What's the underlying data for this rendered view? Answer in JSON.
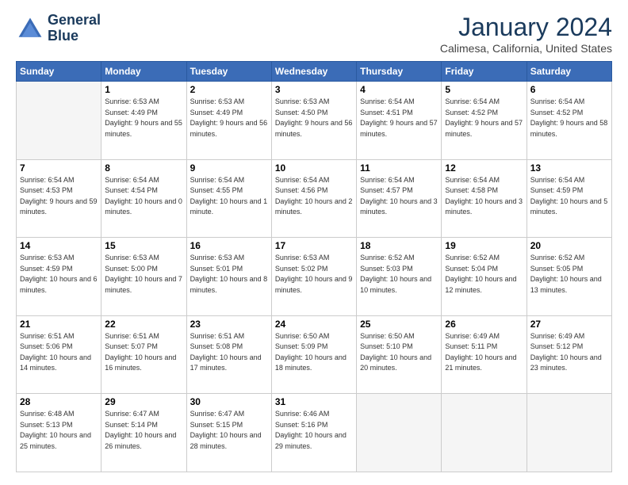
{
  "header": {
    "logo_line1": "General",
    "logo_line2": "Blue",
    "month_year": "January 2024",
    "location": "Calimesa, California, United States"
  },
  "weekdays": [
    "Sunday",
    "Monday",
    "Tuesday",
    "Wednesday",
    "Thursday",
    "Friday",
    "Saturday"
  ],
  "weeks": [
    [
      {
        "day": "",
        "sunrise": "",
        "sunset": "",
        "daylight": "",
        "empty": true
      },
      {
        "day": "1",
        "sunrise": "Sunrise: 6:53 AM",
        "sunset": "Sunset: 4:49 PM",
        "daylight": "Daylight: 9 hours and 55 minutes."
      },
      {
        "day": "2",
        "sunrise": "Sunrise: 6:53 AM",
        "sunset": "Sunset: 4:49 PM",
        "daylight": "Daylight: 9 hours and 56 minutes."
      },
      {
        "day": "3",
        "sunrise": "Sunrise: 6:53 AM",
        "sunset": "Sunset: 4:50 PM",
        "daylight": "Daylight: 9 hours and 56 minutes."
      },
      {
        "day": "4",
        "sunrise": "Sunrise: 6:54 AM",
        "sunset": "Sunset: 4:51 PM",
        "daylight": "Daylight: 9 hours and 57 minutes."
      },
      {
        "day": "5",
        "sunrise": "Sunrise: 6:54 AM",
        "sunset": "Sunset: 4:52 PM",
        "daylight": "Daylight: 9 hours and 57 minutes."
      },
      {
        "day": "6",
        "sunrise": "Sunrise: 6:54 AM",
        "sunset": "Sunset: 4:52 PM",
        "daylight": "Daylight: 9 hours and 58 minutes."
      }
    ],
    [
      {
        "day": "7",
        "sunrise": "Sunrise: 6:54 AM",
        "sunset": "Sunset: 4:53 PM",
        "daylight": "Daylight: 9 hours and 59 minutes."
      },
      {
        "day": "8",
        "sunrise": "Sunrise: 6:54 AM",
        "sunset": "Sunset: 4:54 PM",
        "daylight": "Daylight: 10 hours and 0 minutes."
      },
      {
        "day": "9",
        "sunrise": "Sunrise: 6:54 AM",
        "sunset": "Sunset: 4:55 PM",
        "daylight": "Daylight: 10 hours and 1 minute."
      },
      {
        "day": "10",
        "sunrise": "Sunrise: 6:54 AM",
        "sunset": "Sunset: 4:56 PM",
        "daylight": "Daylight: 10 hours and 2 minutes."
      },
      {
        "day": "11",
        "sunrise": "Sunrise: 6:54 AM",
        "sunset": "Sunset: 4:57 PM",
        "daylight": "Daylight: 10 hours and 3 minutes."
      },
      {
        "day": "12",
        "sunrise": "Sunrise: 6:54 AM",
        "sunset": "Sunset: 4:58 PM",
        "daylight": "Daylight: 10 hours and 3 minutes."
      },
      {
        "day": "13",
        "sunrise": "Sunrise: 6:54 AM",
        "sunset": "Sunset: 4:59 PM",
        "daylight": "Daylight: 10 hours and 5 minutes."
      }
    ],
    [
      {
        "day": "14",
        "sunrise": "Sunrise: 6:53 AM",
        "sunset": "Sunset: 4:59 PM",
        "daylight": "Daylight: 10 hours and 6 minutes."
      },
      {
        "day": "15",
        "sunrise": "Sunrise: 6:53 AM",
        "sunset": "Sunset: 5:00 PM",
        "daylight": "Daylight: 10 hours and 7 minutes."
      },
      {
        "day": "16",
        "sunrise": "Sunrise: 6:53 AM",
        "sunset": "Sunset: 5:01 PM",
        "daylight": "Daylight: 10 hours and 8 minutes."
      },
      {
        "day": "17",
        "sunrise": "Sunrise: 6:53 AM",
        "sunset": "Sunset: 5:02 PM",
        "daylight": "Daylight: 10 hours and 9 minutes."
      },
      {
        "day": "18",
        "sunrise": "Sunrise: 6:52 AM",
        "sunset": "Sunset: 5:03 PM",
        "daylight": "Daylight: 10 hours and 10 minutes."
      },
      {
        "day": "19",
        "sunrise": "Sunrise: 6:52 AM",
        "sunset": "Sunset: 5:04 PM",
        "daylight": "Daylight: 10 hours and 12 minutes."
      },
      {
        "day": "20",
        "sunrise": "Sunrise: 6:52 AM",
        "sunset": "Sunset: 5:05 PM",
        "daylight": "Daylight: 10 hours and 13 minutes."
      }
    ],
    [
      {
        "day": "21",
        "sunrise": "Sunrise: 6:51 AM",
        "sunset": "Sunset: 5:06 PM",
        "daylight": "Daylight: 10 hours and 14 minutes."
      },
      {
        "day": "22",
        "sunrise": "Sunrise: 6:51 AM",
        "sunset": "Sunset: 5:07 PM",
        "daylight": "Daylight: 10 hours and 16 minutes."
      },
      {
        "day": "23",
        "sunrise": "Sunrise: 6:51 AM",
        "sunset": "Sunset: 5:08 PM",
        "daylight": "Daylight: 10 hours and 17 minutes."
      },
      {
        "day": "24",
        "sunrise": "Sunrise: 6:50 AM",
        "sunset": "Sunset: 5:09 PM",
        "daylight": "Daylight: 10 hours and 18 minutes."
      },
      {
        "day": "25",
        "sunrise": "Sunrise: 6:50 AM",
        "sunset": "Sunset: 5:10 PM",
        "daylight": "Daylight: 10 hours and 20 minutes."
      },
      {
        "day": "26",
        "sunrise": "Sunrise: 6:49 AM",
        "sunset": "Sunset: 5:11 PM",
        "daylight": "Daylight: 10 hours and 21 minutes."
      },
      {
        "day": "27",
        "sunrise": "Sunrise: 6:49 AM",
        "sunset": "Sunset: 5:12 PM",
        "daylight": "Daylight: 10 hours and 23 minutes."
      }
    ],
    [
      {
        "day": "28",
        "sunrise": "Sunrise: 6:48 AM",
        "sunset": "Sunset: 5:13 PM",
        "daylight": "Daylight: 10 hours and 25 minutes."
      },
      {
        "day": "29",
        "sunrise": "Sunrise: 6:47 AM",
        "sunset": "Sunset: 5:14 PM",
        "daylight": "Daylight: 10 hours and 26 minutes."
      },
      {
        "day": "30",
        "sunrise": "Sunrise: 6:47 AM",
        "sunset": "Sunset: 5:15 PM",
        "daylight": "Daylight: 10 hours and 28 minutes."
      },
      {
        "day": "31",
        "sunrise": "Sunrise: 6:46 AM",
        "sunset": "Sunset: 5:16 PM",
        "daylight": "Daylight: 10 hours and 29 minutes."
      },
      {
        "day": "",
        "sunrise": "",
        "sunset": "",
        "daylight": "",
        "empty": true
      },
      {
        "day": "",
        "sunrise": "",
        "sunset": "",
        "daylight": "",
        "empty": true
      },
      {
        "day": "",
        "sunrise": "",
        "sunset": "",
        "daylight": "",
        "empty": true
      }
    ]
  ]
}
